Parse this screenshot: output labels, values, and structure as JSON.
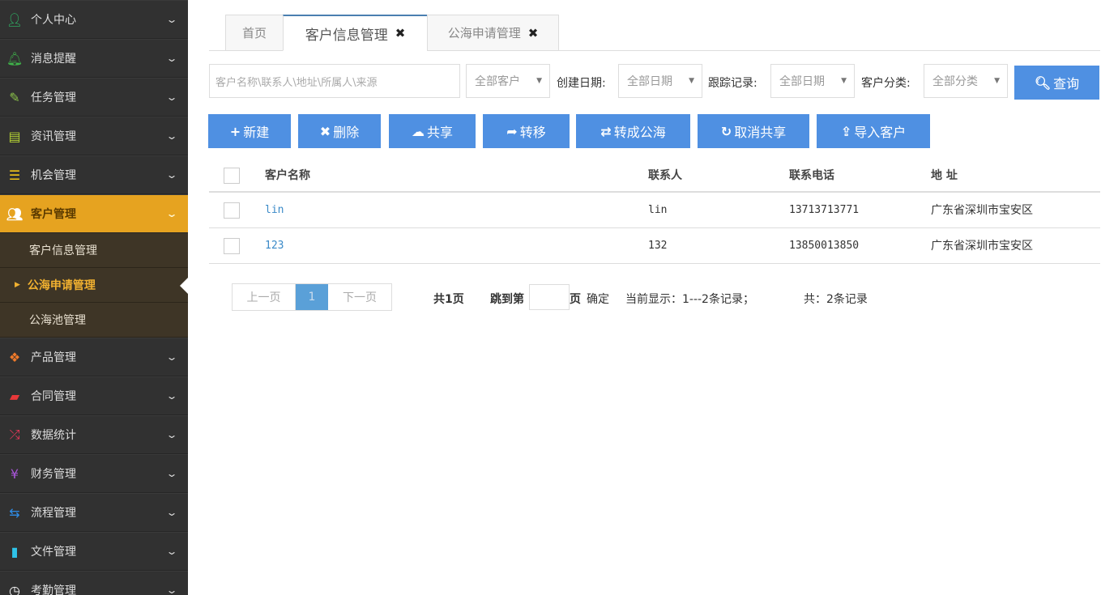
{
  "sidebar": {
    "items": [
      {
        "label": "个人中心",
        "icon": "user-icon",
        "color": "#2fbf6a"
      },
      {
        "label": "消息提醒",
        "icon": "bell-icon",
        "color": "#3fb34a"
      },
      {
        "label": "任务管理",
        "icon": "edit-icon",
        "color": "#8bc34a"
      },
      {
        "label": "资讯管理",
        "icon": "document-icon",
        "color": "#b5d334"
      },
      {
        "label": "机会管理",
        "icon": "list-icon",
        "color": "#f2c318"
      },
      {
        "label": "客户管理",
        "icon": "users-icon",
        "color": "#ffffff"
      },
      {
        "label": "产品管理",
        "icon": "dropbox-icon",
        "color": "#f07a2a"
      },
      {
        "label": "合同管理",
        "icon": "folder-icon",
        "color": "#e8383a"
      },
      {
        "label": "数据统计",
        "icon": "shuffle-icon",
        "color": "#e8385a"
      },
      {
        "label": "财务管理",
        "icon": "yen-icon",
        "color": "#a855d8"
      },
      {
        "label": "流程管理",
        "icon": "retweet-icon",
        "color": "#2f8ee8"
      },
      {
        "label": "文件管理",
        "icon": "file-icon",
        "color": "#2fc3e8"
      },
      {
        "label": "考勤管理",
        "icon": "clock-icon",
        "color": "#ffffff"
      }
    ],
    "sub_items": [
      {
        "label": "客户信息管理"
      },
      {
        "label": "公海申请管理"
      },
      {
        "label": "公海池管理"
      }
    ]
  },
  "tabs": [
    {
      "label": "首页"
    },
    {
      "label": "客户信息管理"
    },
    {
      "label": "公海申请管理"
    }
  ],
  "filters": {
    "search_placeholder": "客户名称\\联系人\\地址\\所属人\\来源",
    "customer_scope": "全部客户",
    "created_label": "创建日期:",
    "created_value": "全部日期",
    "track_label": "跟踪记录:",
    "track_value": "全部日期",
    "category_label": "客户分类:",
    "category_value": "全部分类",
    "query": "查询"
  },
  "actions": [
    {
      "label": "新建",
      "icon": "+"
    },
    {
      "label": "删除",
      "icon": "✖"
    },
    {
      "label": "共享",
      "icon": "☁"
    },
    {
      "label": "转移",
      "icon": "➦"
    },
    {
      "label": "转成公海",
      "icon": "⇄"
    },
    {
      "label": "取消共享",
      "icon": "↻"
    },
    {
      "label": "导入客户",
      "icon": "⇪"
    }
  ],
  "table": {
    "headers": [
      "客户名称",
      "联系人",
      "联系电话",
      "地 址"
    ],
    "rows": [
      [
        "lin",
        "lin",
        "13713713771",
        "广东省深圳市宝安区"
      ],
      [
        "123",
        "132",
        "13850013850",
        "广东省深圳市宝安区"
      ]
    ]
  },
  "pager": {
    "prev": "上一页",
    "current": "1",
    "next": "下一页",
    "total_pages": "共1页",
    "jump_label": "跳到第",
    "page_unit": "页",
    "confirm": "确定",
    "showing": "当前显示：1---2条记录；",
    "total": "共：2条记录"
  }
}
